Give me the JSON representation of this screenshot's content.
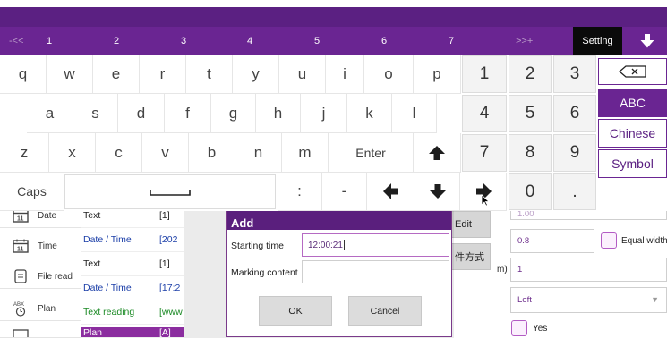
{
  "keyboard_candidates": {
    "prev": "-<<",
    "items": [
      "1",
      "2",
      "3",
      "4",
      "5",
      "6",
      "7"
    ],
    "next": ">>+",
    "setting_label": "Setting"
  },
  "keyboard": {
    "row1": [
      "q",
      "w",
      "e",
      "r",
      "t",
      "y",
      "u",
      "i",
      "o",
      "p"
    ],
    "row2": [
      "a",
      "s",
      "d",
      "f",
      "g",
      "h",
      "j",
      "k",
      "l"
    ],
    "row3": [
      "z",
      "x",
      "c",
      "v",
      "b",
      "n",
      "m"
    ],
    "enter_label": "Enter",
    "caps_label": "Caps",
    "colon": ":",
    "minus": "-",
    "numpad": [
      "1",
      "2",
      "3",
      "4",
      "5",
      "6",
      "7",
      "8",
      "9",
      "0",
      "."
    ],
    "modes": [
      "ABC",
      "Chinese",
      "Symbol"
    ],
    "active_mode": "ABC"
  },
  "sidebar": {
    "items": [
      {
        "label": "Date",
        "icon": "calendar-icon"
      },
      {
        "label": "Time",
        "icon": "calendar-clock-icon"
      },
      {
        "label": "File read",
        "icon": "file-icon"
      },
      {
        "label": "Plan",
        "icon": "plan-clock-icon"
      },
      {
        "label": "",
        "icon": "counter-icon"
      }
    ]
  },
  "table": {
    "rows": [
      {
        "type": "Text",
        "value": "[1]",
        "style": "plain"
      },
      {
        "type": "Date / Time",
        "value": "[202",
        "style": "blue"
      },
      {
        "type": "Text",
        "value": "[1]",
        "style": "plain"
      },
      {
        "type": "Date / Time",
        "value": "[17:2",
        "style": "blue"
      },
      {
        "type": "Text reading",
        "value": "[www",
        "style": "green"
      },
      {
        "type": "Plan",
        "value": "[A]",
        "style": "selected"
      }
    ]
  },
  "right_panel": {
    "edit_button": "Edit",
    "chinese_button": "件方式",
    "top_value": "1.00",
    "value_08": "0.8",
    "equal_width_label": "Equal width",
    "unit_suffix": "m)",
    "value_1": "1",
    "align_value": "Left",
    "yes_label": "Yes"
  },
  "dialog": {
    "title": "Add",
    "starting_time_label": "Starting time",
    "starting_time_value": "12:00:21",
    "marking_content_label": "Marking content",
    "marking_content_value": "",
    "ok_label": "OK",
    "cancel_label": "Cancel"
  },
  "colors": {
    "primary": "#6a2592",
    "primary_dark": "#5b2082",
    "selected_row": "#8b2d9f",
    "date_blue": "#1c3fa8",
    "text_reading_green": "#1b8a25"
  }
}
